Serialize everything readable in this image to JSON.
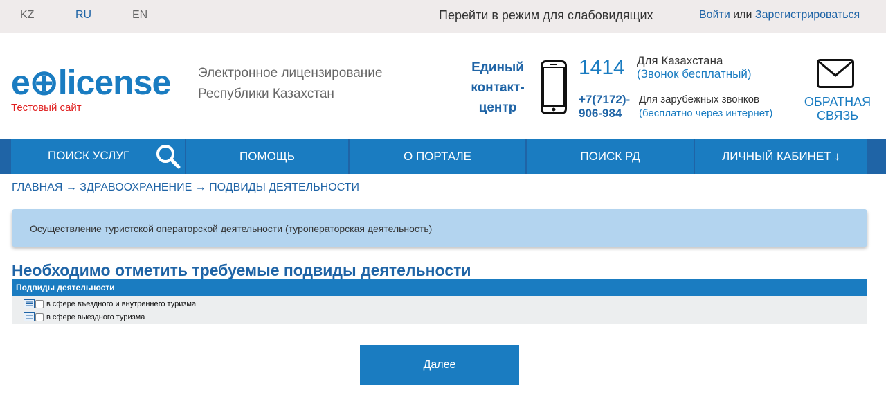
{
  "topbar": {
    "languages": [
      "KZ",
      "RU",
      "EN"
    ],
    "low_vision": "Перейти в режим для слабовидящих",
    "login": "Войти",
    "or": "или",
    "register": "Зарегистрироваться"
  },
  "header": {
    "logo_text": "e⊕license",
    "logo_test": "Тестовый сайт",
    "logo_desc_line1": "Электронное лицензирование",
    "logo_desc_line2": "Республики Казахстан",
    "contact_title_1": "Единый",
    "contact_title_2": "контакт-",
    "contact_title_3": "центр",
    "phone_number": "1414",
    "phone_kz": "Для Казахстана",
    "phone_kz_note": "(Звонок бесплатный)",
    "intl_number_1": "+7(7172)-",
    "intl_number_2": "906-984",
    "intl_text": "Для зарубежных звонков",
    "intl_note": "(бесплатно через интернет)",
    "feedback_1": "ОБРАТНАЯ",
    "feedback_2": "СВЯЗЬ"
  },
  "nav": {
    "search": "Поиск услуг",
    "help": "Помощь",
    "about": "О портале",
    "rd": "Поиск РД",
    "cabinet": "Личный кабинет ↓"
  },
  "breadcrumb": {
    "home": "Главная",
    "section": "Здравоохранение",
    "current": "Подвиды деятельности",
    "sep": " → "
  },
  "activity": "Осуществление туристской операторской деятельности (туроператорская деятельность)",
  "page_title": "Необходимо отметить требуемые подвиды деятельности",
  "grid": {
    "header": "Подвиды деятельности",
    "rows": [
      {
        "label": "в сфере въездного и внутреннего туризма",
        "checked": false
      },
      {
        "label": "в сфере выездного туризма",
        "checked": false
      }
    ]
  },
  "next_button": "Далее",
  "colors": {
    "primary": "#1a7cc1",
    "dark": "#1f64a6",
    "box": "#b3d4ef",
    "test": "#e02020"
  }
}
